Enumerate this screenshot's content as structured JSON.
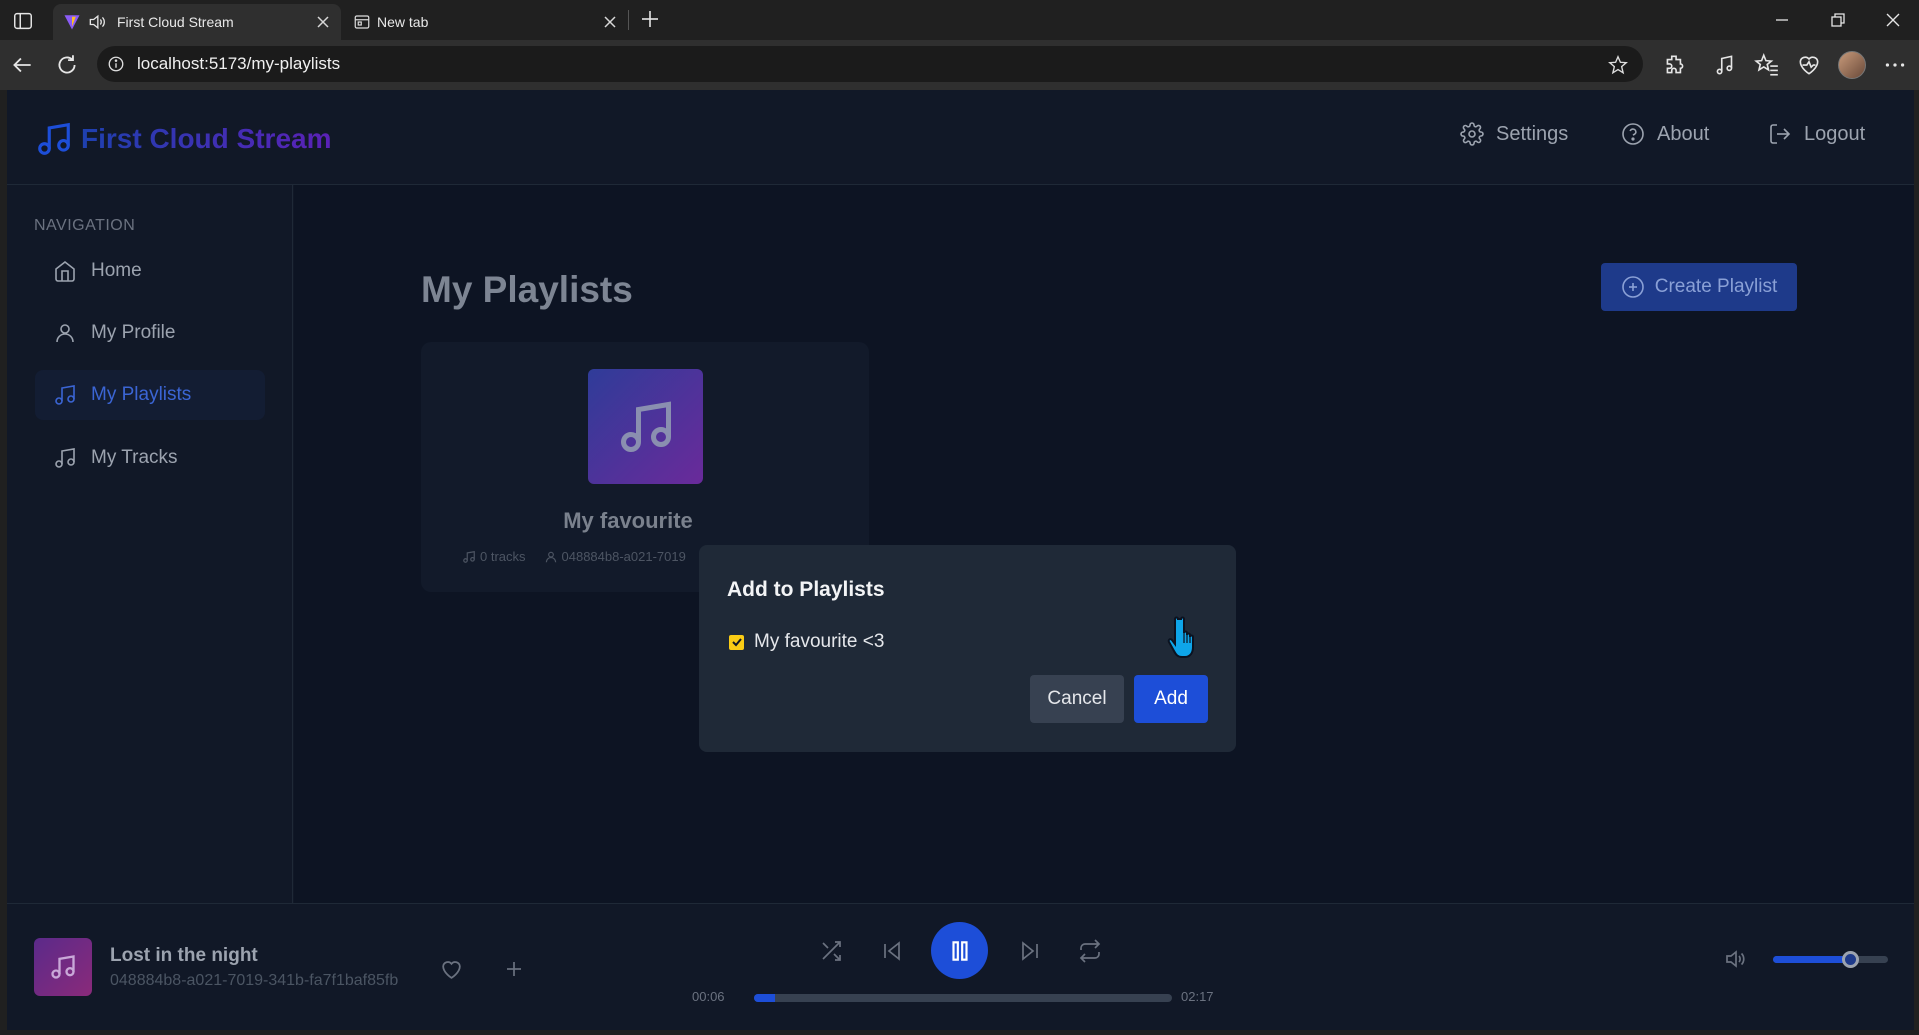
{
  "browser": {
    "tabs": [
      {
        "title": "First Cloud Stream",
        "active": true
      },
      {
        "title": "New tab",
        "active": false
      }
    ],
    "url": "localhost:5173/my-playlists"
  },
  "header": {
    "brand": "First Cloud Stream",
    "nav": [
      {
        "label": "Settings",
        "icon": "gear-icon"
      },
      {
        "label": "About",
        "icon": "help-circle-icon"
      },
      {
        "label": "Logout",
        "icon": "logout-icon"
      }
    ]
  },
  "sidebar": {
    "heading": "NAVIGATION",
    "items": [
      {
        "label": "Home",
        "icon": "home-icon",
        "active": false
      },
      {
        "label": "My Profile",
        "icon": "user-icon",
        "active": false
      },
      {
        "label": "My Playlists",
        "icon": "music-note-icon",
        "active": true
      },
      {
        "label": "My Tracks",
        "icon": "music-note-icon",
        "active": false
      }
    ]
  },
  "main": {
    "title": "My Playlists",
    "create_label": "Create Playlist",
    "playlists": [
      {
        "name": "My favourite",
        "tracks": "0 tracks",
        "owner": "048884b8-a021-7019"
      }
    ]
  },
  "modal": {
    "title": "Add to Playlists",
    "options": [
      {
        "label": "My favourite <3",
        "checked": true
      }
    ],
    "cancel_label": "Cancel",
    "add_label": "Add"
  },
  "player": {
    "title": "Lost in the night",
    "artist": "048884b8-a021-7019-341b-fa7f1baf85fb",
    "current_time": "00:06",
    "duration": "02:17",
    "progress_fraction": 0.05,
    "volume_fraction": 0.67,
    "state": "playing"
  },
  "colors": {
    "accent": "#1d4ed8",
    "background": "#111827",
    "modal": "#1f2937",
    "checkbox": "#facc15"
  }
}
